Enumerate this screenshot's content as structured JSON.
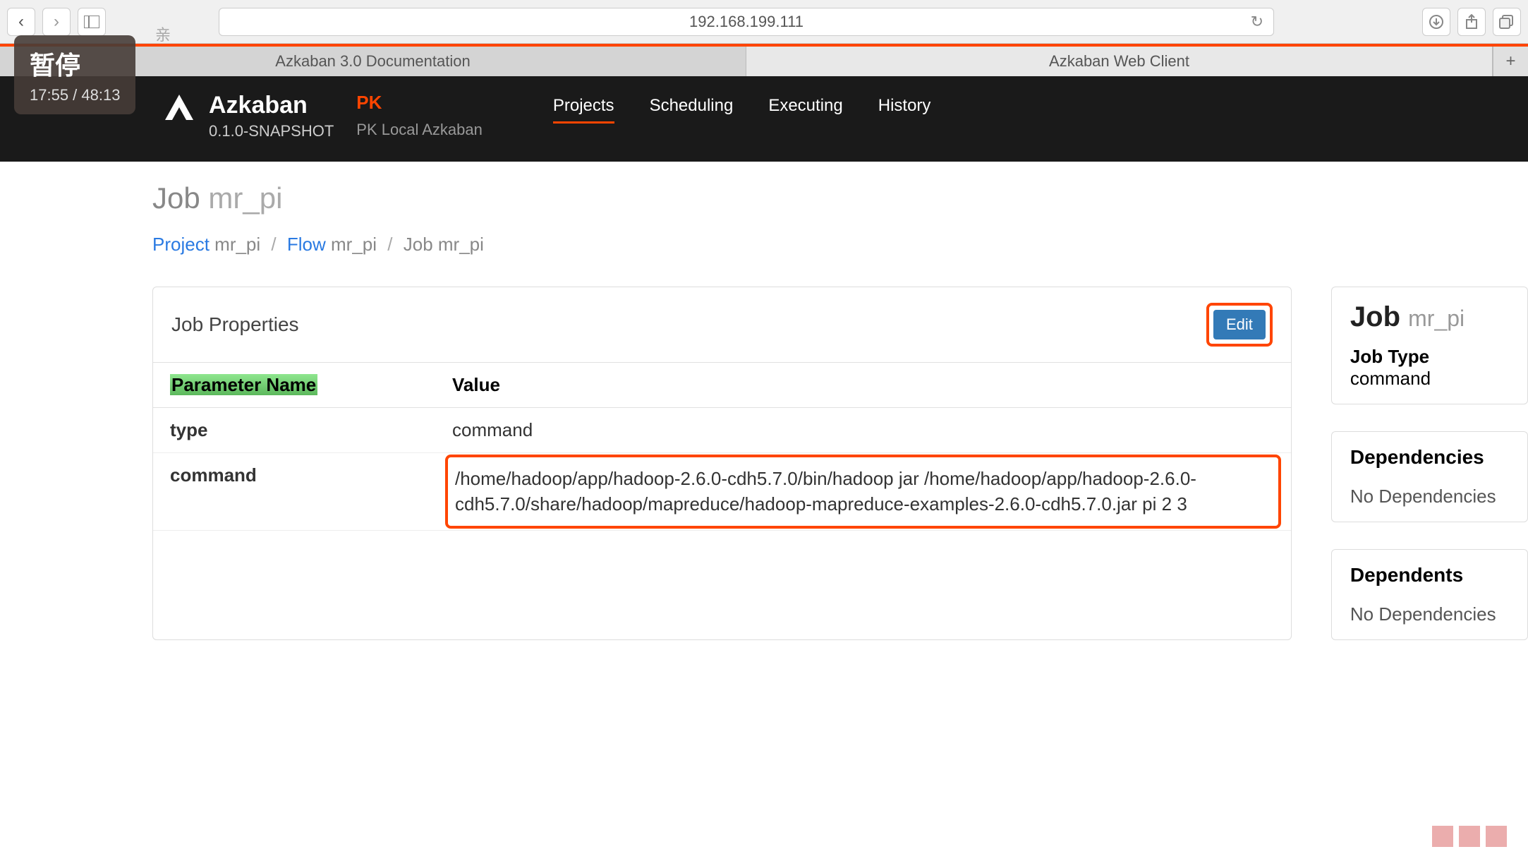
{
  "browser": {
    "url": "192.168.199.111",
    "tabs": [
      {
        "title": "Azkaban 3.0 Documentation"
      },
      {
        "title": "Azkaban Web Client"
      }
    ],
    "mini_char": "亲"
  },
  "video_overlay": {
    "pause": "暂停",
    "time": "17:55 / 48:13"
  },
  "header": {
    "brand": "Azkaban",
    "version": "0.1.0-SNAPSHOT",
    "instance_name": "PK",
    "instance_desc": "PK Local Azkaban",
    "nav": [
      {
        "label": "Projects",
        "active": true
      },
      {
        "label": "Scheduling",
        "active": false
      },
      {
        "label": "Executing",
        "active": false
      },
      {
        "label": "History",
        "active": false
      }
    ]
  },
  "page": {
    "title_prefix": "Job",
    "title_name": "mr_pi"
  },
  "breadcrumb": {
    "project_label": "Project",
    "project_name": "mr_pi",
    "flow_label": "Flow",
    "flow_name": "mr_pi",
    "job_label": "Job",
    "job_name": "mr_pi"
  },
  "panel": {
    "title": "Job Properties",
    "edit_label": "Edit",
    "col_param": "Parameter Name",
    "col_value": "Value",
    "rows": [
      {
        "name": "type",
        "value": "command"
      },
      {
        "name": "command",
        "value": "/home/hadoop/app/hadoop-2.6.0-cdh5.7.0/bin/hadoop jar /home/hadoop/app/hadoop-2.6.0-cdh5.7.0/share/hadoop/mapreduce/hadoop-mapreduce-examples-2.6.0-cdh5.7.0.jar pi 2 3"
      }
    ]
  },
  "sidebar": {
    "job_label": "Job",
    "job_name": "mr_pi",
    "jobtype_label": "Job Type",
    "jobtype_value": "command",
    "deps_title": "Dependencies",
    "deps_body": "No Dependencies",
    "depts_title": "Dependents",
    "depts_body": "No Dependencies"
  }
}
